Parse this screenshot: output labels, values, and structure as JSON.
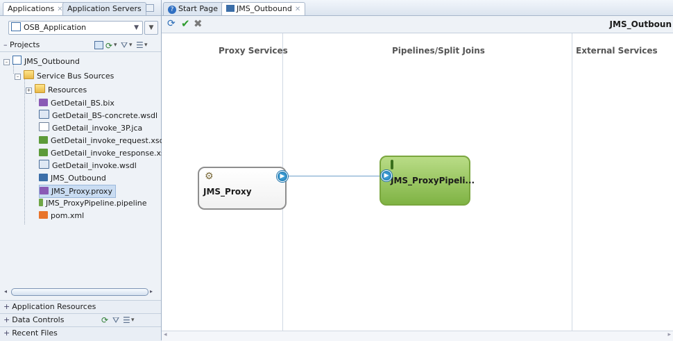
{
  "left_panel": {
    "tabs": [
      {
        "label": "Applications"
      },
      {
        "label": "Application Servers"
      }
    ],
    "app_selector": {
      "value": "OSB_Application"
    },
    "projects_label": "Projects",
    "tree": {
      "root": "JMS_Outbound",
      "folder": "Service Bus Sources",
      "subfolder": "Resources",
      "files": [
        "GetDetail_BS.bix",
        "GetDetail_BS-concrete.wsdl",
        "GetDetail_invoke_3P.jca",
        "GetDetail_invoke_request.xsd",
        "GetDetail_invoke_response.xsd",
        "GetDetail_invoke.wsdl",
        "JMS_Outbound",
        "JMS_Proxy.proxy",
        "JMS_ProxyPipeline.pipeline",
        "pom.xml"
      ]
    },
    "bottom_sections": [
      "Application Resources",
      "Data Controls",
      "Recent Files"
    ]
  },
  "editor": {
    "tabs": [
      {
        "label": "Start Page"
      },
      {
        "label": "JMS_Outbound"
      }
    ],
    "title": "JMS_Outboun",
    "columns": [
      "Proxy Services",
      "Pipelines/Split Joins",
      "External Services"
    ],
    "proxy_node": {
      "label": "JMS_Proxy"
    },
    "pipeline_node": {
      "label": "JMS_ProxyPipeli..."
    }
  },
  "colors": {
    "tree_selection": "#c9dcf2",
    "pipeline_fill": "#8fc352",
    "port": "#1a6fa7"
  }
}
